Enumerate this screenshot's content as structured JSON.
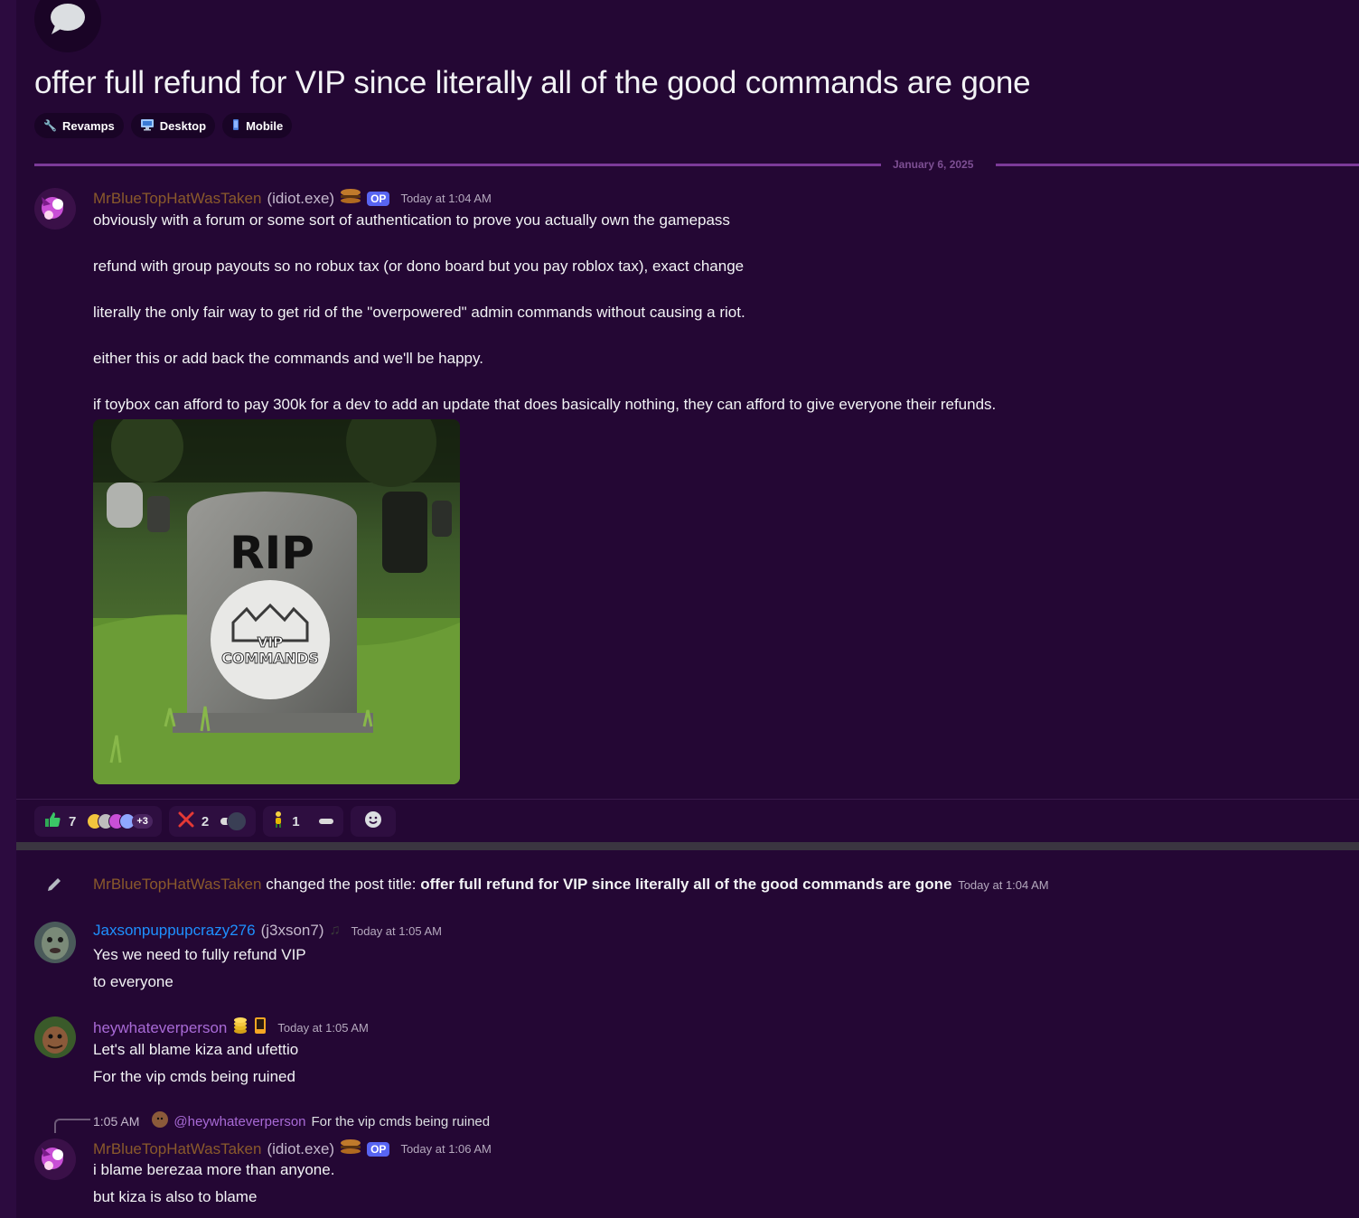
{
  "thread": {
    "title": "offer full refund for VIP since literally all of the good commands are gone",
    "tags": [
      {
        "label": "Revamps",
        "icon": "wrench-icon"
      },
      {
        "label": "Desktop",
        "icon": "desktop-icon"
      },
      {
        "label": "Mobile",
        "icon": "mobile-icon"
      }
    ],
    "date_divider": "January 6, 2025"
  },
  "colors": {
    "background": "#240734",
    "op_username": "#8a5a2b",
    "jaxson_username": "#1e90ff",
    "hey_username": "#a86ad6",
    "op_badge": "#5865f2",
    "accent_divider": "#7c3a99"
  },
  "messages": {
    "m1": {
      "username": "MrBlueTopHatWasTaken",
      "alias": "(idiot.exe)",
      "badge": "OP",
      "timestamp": "Today at 1:04 AM",
      "lines": [
        "obviously with a forum or some sort of authentication to prove you actually own the gamepass",
        "refund with group payouts so no robux tax (or dono board but you pay roblox tax), exact change",
        "literally the only fair way to get rid of the \"overpowered\" admin commands without causing a riot.",
        "either this or add back the commands and we'll be happy.",
        "if toybox can afford to pay 300k for a dev to add an update that does basically nothing, they can afford to give everyone their refunds."
      ],
      "attachment": {
        "main_text": "RIP",
        "emblem_top": "VIP",
        "emblem_bottom": "COMMANDS"
      }
    },
    "reactions": [
      {
        "emoji": "thumbs-up-icon",
        "count": "7",
        "more": "+3"
      },
      {
        "emoji": "cross-mark-icon",
        "count": "2"
      },
      {
        "emoji": "figure-icon",
        "count": "1"
      },
      {
        "emoji": "add-reaction-icon"
      }
    ],
    "system": {
      "username": "MrBlueTopHatWasTaken",
      "action": "changed the post title:",
      "new_title": "offer full refund for VIP since literally all of the good commands are gone",
      "timestamp": "Today at 1:04 AM"
    },
    "m2": {
      "username": "Jaxsonpuppupcrazy276",
      "alias": "(j3xson7)",
      "timestamp": "Today at 1:05 AM",
      "lines": [
        "Yes we need to fully refund VIP",
        "to everyone"
      ]
    },
    "m3": {
      "username": "heywhateverperson",
      "timestamp": "Today at 1:05 AM",
      "lines": [
        "Let's all blame kiza and ufettio",
        "For the vip cmds being ruined"
      ]
    },
    "m4": {
      "reply_time": "1:05 AM",
      "reply_mention": "@heywhateverperson",
      "reply_text": "For the vip cmds being ruined",
      "username": "MrBlueTopHatWasTaken",
      "alias": "(idiot.exe)",
      "badge": "OP",
      "timestamp": "Today at 1:06 AM",
      "lines": [
        "i blame berezaa more than anyone.",
        "but kiza is also to blame"
      ]
    }
  }
}
